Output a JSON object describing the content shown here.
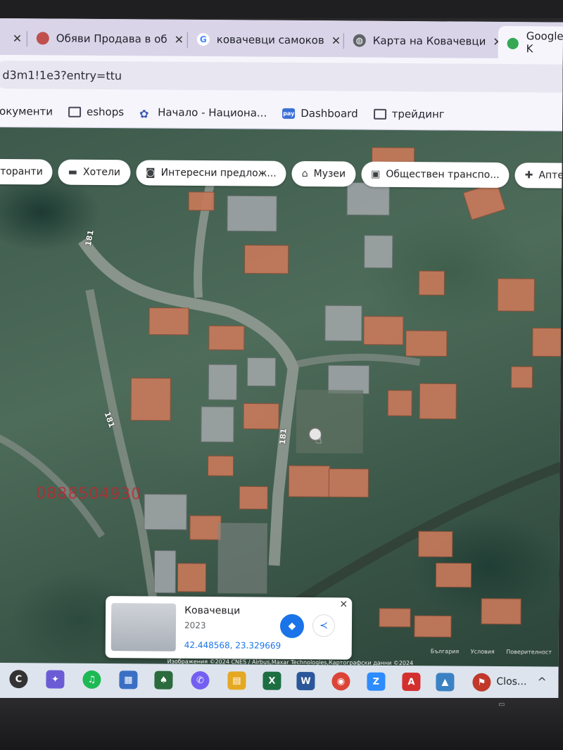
{
  "browser": {
    "tabs": [
      {
        "label": "Обяви Продава в об",
        "icon": "record-icon",
        "color": "#c0504d"
      },
      {
        "label": "ковачевци самоков",
        "icon": "google-g-icon",
        "color": "#4285f4"
      },
      {
        "label": "Карта на Ковачевци",
        "icon": "globe-icon",
        "color": "#5f6368"
      },
      {
        "label": "Google K",
        "icon": "google-maps-icon",
        "color": "#34a853"
      }
    ],
    "address": "d3m1!1e3?entry=ttu",
    "bookmarks": [
      {
        "label": "окументи",
        "icon": "doc-icon"
      },
      {
        "label": "eshops",
        "icon": "folder-icon"
      },
      {
        "label": "Начало - Национа...",
        "icon": "site-icon"
      },
      {
        "label": "Dashboard",
        "icon": "pay-icon",
        "badge": "pay"
      },
      {
        "label": "трейдинг",
        "icon": "folder-icon"
      }
    ]
  },
  "map": {
    "chips": [
      {
        "label": "сторанти",
        "icon": "restaurant-icon",
        "glyph": ""
      },
      {
        "label": "Хотели",
        "icon": "bed-icon",
        "glyph": "▬"
      },
      {
        "label": "Интересни предлож...",
        "icon": "camera-icon",
        "glyph": "◙"
      },
      {
        "label": "Музеи",
        "icon": "museum-icon",
        "glyph": "⌂"
      },
      {
        "label": "Обществен транспо...",
        "icon": "bus-icon",
        "glyph": "▣"
      },
      {
        "label": "Аптеки",
        "icon": "pharmacy-icon",
        "glyph": "✚"
      }
    ],
    "road_number": "181",
    "watermark_phone": "0888504930",
    "attribution": "Изображения ©2024 CNES / Airbus,Maxar Technologies,Картографски данни ©2024",
    "attribution_right": [
      "България",
      "Условия",
      "Поверителност"
    ],
    "info_card": {
      "title": "Ковачевци",
      "year": "2023",
      "coords": "42.448568, 23.329669"
    }
  },
  "taskbar": {
    "apps": [
      {
        "name": "cortana-icon",
        "glyph": "C",
        "color": "#333"
      },
      {
        "name": "tool-icon",
        "glyph": "✦",
        "color": "#6b5cd6"
      },
      {
        "name": "spotify-icon",
        "glyph": "♫",
        "color": "#1db954"
      },
      {
        "name": "control-icon",
        "glyph": "▦",
        "color": "#3a6fc4"
      },
      {
        "name": "solitaire-icon",
        "glyph": "♠",
        "color": "#2b6b3d"
      },
      {
        "name": "viber-icon",
        "glyph": "✆",
        "color": "#7360f2"
      },
      {
        "name": "explorer-icon",
        "glyph": "▤",
        "color": "#e5a823"
      },
      {
        "name": "excel-icon",
        "glyph": "X",
        "color": "#1d6f42"
      },
      {
        "name": "word-icon",
        "glyph": "W",
        "color": "#2b579a"
      },
      {
        "name": "chrome-icon",
        "glyph": "◉",
        "color": "#db4437"
      },
      {
        "name": "zoom-icon",
        "glyph": "Z",
        "color": "#2d8cff"
      },
      {
        "name": "acrobat-icon",
        "glyph": "A",
        "color": "#d32f2f"
      },
      {
        "name": "photos-icon",
        "glyph": "▲",
        "color": "#3b82c4"
      },
      {
        "name": "app-icon",
        "glyph": "⚑",
        "color": "#c0392b"
      }
    ],
    "window_label": "Clos..."
  }
}
